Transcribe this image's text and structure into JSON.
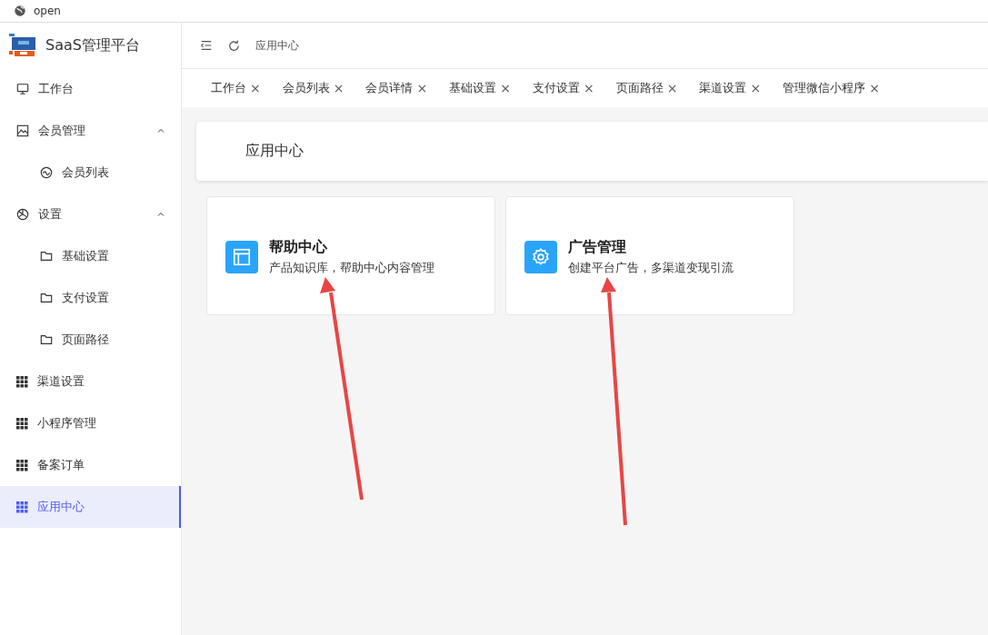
{
  "browser_bar": {
    "title": "open"
  },
  "brand": {
    "name": "SaaS管理平台"
  },
  "sidebar": {
    "items": [
      {
        "label": "工作台",
        "selected": false
      },
      {
        "label": "会员管理",
        "selected": false,
        "expanded": true,
        "children": [
          {
            "label": "会员列表",
            "selected": false
          }
        ]
      },
      {
        "label": "设置",
        "selected": false,
        "expanded": true,
        "children": [
          {
            "label": "基础设置",
            "selected": false
          },
          {
            "label": "支付设置",
            "selected": false
          },
          {
            "label": "页面路径",
            "selected": false
          }
        ]
      },
      {
        "label": "渠道设置",
        "selected": false
      },
      {
        "label": "小程序管理",
        "selected": false
      },
      {
        "label": "备案订单",
        "selected": false
      },
      {
        "label": "应用中心",
        "selected": true
      }
    ]
  },
  "header": {
    "breadcrumb": "应用中心"
  },
  "tabs": [
    {
      "label": "工作台",
      "close": "×"
    },
    {
      "label": "会员列表",
      "close": "×"
    },
    {
      "label": "会员详情",
      "close": "×"
    },
    {
      "label": "基础设置",
      "close": "×"
    },
    {
      "label": "支付设置",
      "close": "×"
    },
    {
      "label": "页面路径",
      "close": "×"
    },
    {
      "label": "渠道设置",
      "close": "×"
    },
    {
      "label": "管理微信小程序",
      "close": "×"
    }
  ],
  "page": {
    "title": "应用中心"
  },
  "apps": [
    {
      "kind": "layout",
      "title": "帮助中心",
      "description": "产品知识库，帮助中心内容管理"
    },
    {
      "kind": "gear",
      "title": "广告管理",
      "description": "创建平台广告，多渠道变现引流"
    }
  ]
}
